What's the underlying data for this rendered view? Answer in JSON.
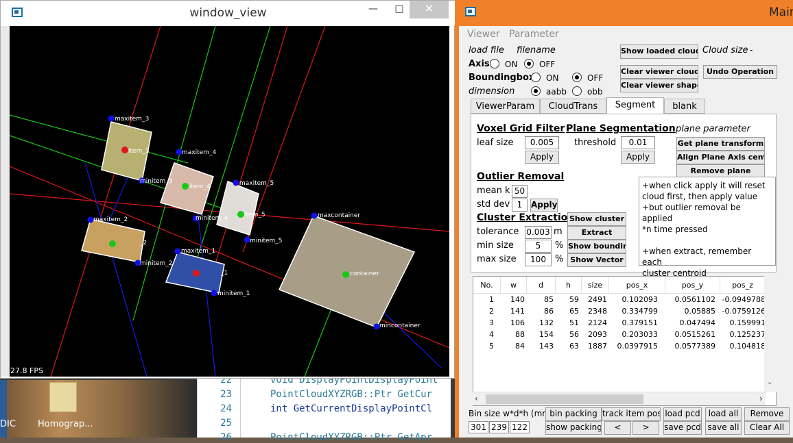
{
  "viewer": {
    "title": "window_view",
    "fps": "27.8 FPS",
    "labels": {
      "maxitem_3": "maxitem_3",
      "maxitem_4": "maxitem_4",
      "maxitem_5": "maxitem_5",
      "maxitem_2": "maxitem_2",
      "maxitem_1": "maxitem_1",
      "maxcontainer": "maxcontainer",
      "minitem_3": "minitem_3",
      "minitem_4": "minitem_4",
      "minitem_5": "minitem_5",
      "minitem_2": "minitem_2",
      "minitem_1": "minitem_1",
      "mincontainer": "mincontainer",
      "item_3": "item_3",
      "item_4": "item_4",
      "item_5": "item_5",
      "item_2": "_2",
      "item_1": "_1",
      "container": "container"
    }
  },
  "code": {
    "lines": [
      {
        "num": "22",
        "text": "void DisplayPointDisplayPoint"
      },
      {
        "num": "23",
        "text": "PointCloudXYZRGB::Ptr GetCur"
      },
      {
        "num": "24",
        "text": "int GetCurrentDisplayPointCl"
      },
      {
        "num": "25",
        "text": ""
      },
      {
        "num": "26",
        "text": "PointCloudXYZRGB::Ptr GetApr"
      }
    ]
  },
  "desktop": {
    "icon_label": "Homograp...",
    "left_label": "DIC"
  },
  "main": {
    "title": "Main",
    "menu": [
      "Viewer",
      "Parameter"
    ],
    "load_file": "load file",
    "filename": "filename",
    "axis": "Axis",
    "on": "ON",
    "off": "OFF",
    "boundingbox": "Boundingbox",
    "dimension": "dimension",
    "aabb": "aabb",
    "obb": "obb",
    "show_loaded_cloud": "Show loaded cloud",
    "cloud_size_label": "Cloud size",
    "cloud_size_value": "-",
    "clear_viewer_cloud": "Clear viewer cloud",
    "undo_operation": "Undo Operation",
    "clear_viewer_shape": "Clear viewer shape",
    "tabs": [
      "ViewerParam",
      "CloudTrans",
      "Segment",
      "blank"
    ],
    "voxel": {
      "title": "Voxel Grid Filter",
      "leaf_size": "leaf size",
      "value": "0.005",
      "apply": "Apply"
    },
    "plane": {
      "title": "Plane Segmentation",
      "threshold": "threshold",
      "value": "0.01",
      "apply": "Apply",
      "param": "plane parameter",
      "get_transform": "Get plane transform",
      "align": "Align Plane Axis center",
      "remove": "Remove plane"
    },
    "outlier": {
      "title": "Outlier Removal",
      "mean_k": "mean k",
      "mean_k_value": "50",
      "std_dev": "std dev",
      "std_dev_value": "1",
      "apply": "Apply"
    },
    "cluster": {
      "title": "Cluster Extraction",
      "tolerance": "tolerance",
      "tolerance_value": "0.003",
      "tolerance_unit": "m",
      "min_size": "min size",
      "min_size_value": "5",
      "max_size": "max size",
      "max_size_value": "100",
      "pct": "%",
      "show_cluster": "Show cluster",
      "extract": "Extract",
      "show_bounding": "Show bounding",
      "show_vector": "Show Vector"
    },
    "note": [
      "+when click apply it will reset",
      "cloud first, then apply value",
      "+but outlier removal be applied",
      "*n time pressed",
      "",
      "+when extract, remember each",
      "cluster centroid"
    ],
    "table": {
      "headers": [
        "No.",
        "w",
        "d",
        "h",
        "size",
        "pos_x",
        "pos_y",
        "pos_z"
      ],
      "rows": [
        [
          "1",
          "140",
          "85",
          "59",
          "2491",
          "0.102093",
          "0.0561102",
          "-0.0949788"
        ],
        [
          "2",
          "141",
          "86",
          "65",
          "2348",
          "0.334799",
          "0.05885",
          "-0.0759126"
        ],
        [
          "3",
          "106",
          "132",
          "51",
          "2124",
          "0.379151",
          "0.047494",
          "0.159991"
        ],
        [
          "4",
          "88",
          "154",
          "56",
          "2093",
          "0.203033",
          "0.0515261",
          "0.125237"
        ],
        [
          "5",
          "84",
          "143",
          "63",
          "1887",
          "0.0397915",
          "0.0577389",
          "0.104818"
        ]
      ]
    },
    "bottom": {
      "bin_size_label": "Bin size w*d*h (mm)",
      "bin_w": "301",
      "bin_d": "239",
      "bin_h": "122",
      "bin_packing": "bin packing",
      "track_item_pos": "track item pos",
      "load_pcd": "load pcd",
      "load_all": "load all",
      "remove": "Remove",
      "show_packing": "show packing",
      "prev": "<",
      "next": ">",
      "save_pcd": "save pcd",
      "save_all": "save all",
      "clear_all": "Clear All"
    }
  },
  "colors": {
    "accent": "#f0812a",
    "red_axis": "#e01818",
    "green_axis": "#18c818",
    "blue_axis": "#1818e8"
  }
}
